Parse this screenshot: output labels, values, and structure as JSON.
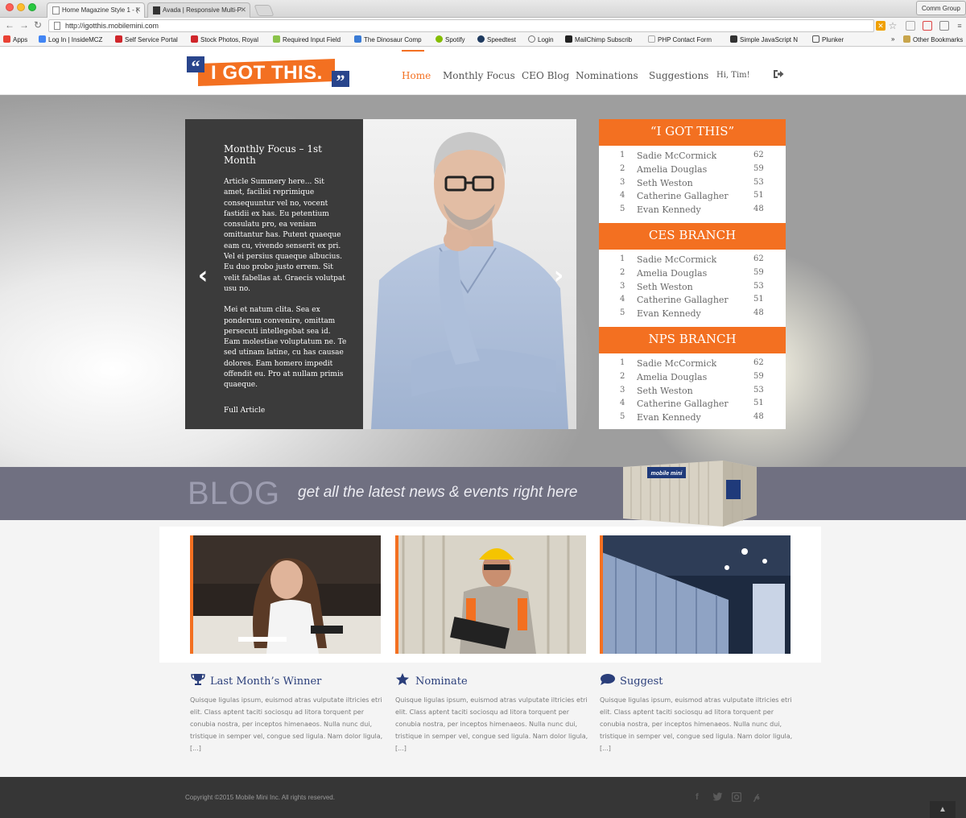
{
  "browser": {
    "tabs": [
      {
        "label": "Home Magazine Style 1 - ("
      },
      {
        "label": "Avada | Responsive Multi-P"
      }
    ],
    "profile": "Comm Group",
    "url": "http://igotthis.mobilemini.com",
    "bookmarks": [
      {
        "label": "Apps",
        "icon": "apps-grid-icon",
        "color": "#e94235"
      },
      {
        "label": "Log In | InsideMCZ",
        "icon": "google-icon",
        "color": "#4285f4"
      },
      {
        "label": "Self Service Portal",
        "icon": "portal-icon",
        "color": "#d0262b"
      },
      {
        "label": "Stock Photos, Royal",
        "icon": "stock-photo-icon",
        "color": "#d0262b"
      },
      {
        "label": "Required Input Field",
        "icon": "input-field-icon",
        "color": "#8bc34a"
      },
      {
        "label": "The Dinosaur Comp",
        "icon": "dinosaur-icon",
        "color": "#3a7bd5"
      },
      {
        "label": "Spotify",
        "icon": "spotify-icon",
        "color": "#84bd00"
      },
      {
        "label": "Speedtest",
        "icon": "speedtest-icon",
        "color": "#1e3a5f"
      },
      {
        "label": "Login",
        "icon": "login-icon",
        "color": "#777777"
      },
      {
        "label": "MailChimp Subscrib",
        "icon": "mailchimp-icon",
        "color": "#222222"
      },
      {
        "label": "PHP Contact Form",
        "icon": "php-icon",
        "color": "#c9c9c9"
      },
      {
        "label": "Simple JavaScript N",
        "icon": "javascript-icon",
        "color": "#333333"
      },
      {
        "label": "Plunker",
        "icon": "plunker-icon",
        "color": "#555555"
      }
    ],
    "overflow": "»",
    "other_bookmarks": "Other Bookmarks"
  },
  "header": {
    "logo_text": "I GOT THIS.",
    "logo_quote_open": "“",
    "logo_quote_close": "”",
    "nav": [
      {
        "label": "Home",
        "active": true
      },
      {
        "label": "Monthly Focus",
        "active": false
      },
      {
        "label": "CEO Blog",
        "active": false
      },
      {
        "label": "Nominations",
        "active": false
      },
      {
        "label": "Suggestions",
        "active": false
      }
    ],
    "greeting": "Hi, Tim!"
  },
  "hero": {
    "slide": {
      "title": "Monthly Focus – 1st Month",
      "para1": "Article Summery here... Sit amet, facilisi reprimique consequuntur vel no, vocent fastidii ex has. Eu petentium consulatu pro, ea veniam omittantur has. Putent quaeque eam cu, vivendo senserit ex pri. Vel ei persius quaeque albucius. Eu duo probo justo errem. Sit velit fabellas at. Graecis volutpat usu no.",
      "para2": "Mei et natum clita. Sea ex ponderum convenire, omittam persecuti intellegebat sea id. Eam molestiae voluptatum ne. Te sed utinam latine, cu has causae dolores. Eam homero impedit offendit eu. Pro at nullam primis quaeque.",
      "link": "Full Article"
    },
    "leaderboards": [
      {
        "title": "“I GOT THIS”",
        "rows": [
          {
            "rank": "1",
            "name": "Sadie McCormick",
            "score": "62"
          },
          {
            "rank": "2",
            "name": "Amelia Douglas",
            "score": "59"
          },
          {
            "rank": "3",
            "name": "Seth Weston",
            "score": "53"
          },
          {
            "rank": "4",
            "name": "Catherine Gallagher",
            "score": "51"
          },
          {
            "rank": "5",
            "name": "Evan Kennedy",
            "score": "48"
          }
        ]
      },
      {
        "title": "CES BRANCH",
        "rows": [
          {
            "rank": "1",
            "name": "Sadie McCormick",
            "score": "62"
          },
          {
            "rank": "2",
            "name": "Amelia Douglas",
            "score": "59"
          },
          {
            "rank": "3",
            "name": "Seth Weston",
            "score": "53"
          },
          {
            "rank": "4",
            "name": "Catherine Gallagher",
            "score": "51"
          },
          {
            "rank": "5",
            "name": "Evan Kennedy",
            "score": "48"
          }
        ]
      },
      {
        "title": "NPS BRANCH",
        "rows": [
          {
            "rank": "1",
            "name": "Sadie McCormick",
            "score": "62"
          },
          {
            "rank": "2",
            "name": "Amelia Douglas",
            "score": "59"
          },
          {
            "rank": "3",
            "name": "Seth Weston",
            "score": "53"
          },
          {
            "rank": "4",
            "name": "Catherine Gallagher",
            "score": "51"
          },
          {
            "rank": "5",
            "name": "Evan Kennedy",
            "score": "48"
          }
        ]
      }
    ]
  },
  "blog": {
    "heading": "BLOG",
    "tagline": "get all the latest news & events right here",
    "container_brand": "mobile mini"
  },
  "features": [
    {
      "title": "Last Month’s Winner",
      "icon": "trophy-icon",
      "body": "Quisque ligulas ipsum, euismod atras vulputate iltricies etri elit. Class aptent taciti sociosqu ad litora torquent per conubia nostra, per inceptos himenaeos. Nulla nunc dui, tristique in semper vel, congue sed ligula. Nam dolor ligula, [...]"
    },
    {
      "title": "Nominate",
      "icon": "star-icon",
      "body": "Quisque ligulas ipsum, euismod atras vulputate iltricies etri elit. Class aptent taciti sociosqu ad litora torquent per conubia nostra, per inceptos himenaeos. Nulla nunc dui, tristique in semper vel, congue sed ligula. Nam dolor ligula, [...]"
    },
    {
      "title": "Suggest",
      "icon": "speech-bubble-icon",
      "body": "Quisque ligulas ipsum, euismod atras vulputate iltricies etri elit. Class aptent taciti sociosqu ad litora torquent per conubia nostra, per inceptos himenaeos. Nulla nunc dui, tristique in semper vel, congue sed ligula. Nam dolor ligula, [...]"
    }
  ],
  "footer": {
    "copyright": "Copyright ©2015 Mobile Mini Inc. All rights reserved.",
    "social": [
      "facebook-icon",
      "twitter-icon",
      "instagram-icon",
      "pinterest-icon"
    ]
  },
  "colors": {
    "accent": "#f37021",
    "brand_blue": "#29458c",
    "blog_band": "#707081",
    "footer": "#363636"
  }
}
